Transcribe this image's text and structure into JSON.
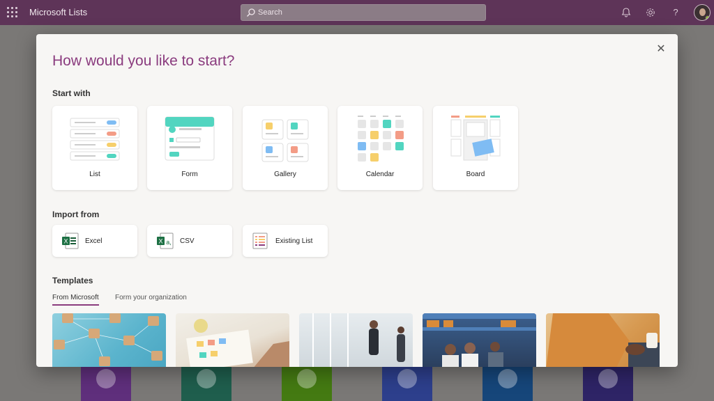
{
  "app": {
    "title": "Microsoft Lists"
  },
  "search": {
    "placeholder": "Search"
  },
  "topbar_icons": [
    "bell-icon",
    "gear-icon",
    "help-icon"
  ],
  "dialog": {
    "title": "How would you like to start?",
    "start_with": {
      "heading": "Start with",
      "options": [
        {
          "label": "List"
        },
        {
          "label": "Form"
        },
        {
          "label": "Gallery"
        },
        {
          "label": "Calendar"
        },
        {
          "label": "Board"
        }
      ]
    },
    "import_from": {
      "heading": "Import from",
      "options": [
        {
          "label": "Excel",
          "icon": "excel-icon"
        },
        {
          "label": "CSV",
          "icon": "csv-icon"
        },
        {
          "label": "Existing List",
          "icon": "existing-list-icon"
        }
      ]
    },
    "templates": {
      "heading": "Templates",
      "tabs": [
        {
          "label": "From Microsoft",
          "active": true
        },
        {
          "label": "Form your organization",
          "active": false
        }
      ]
    }
  },
  "colors": {
    "brand": "#5e3458",
    "accent": "#8a3b7e",
    "blue": "#7fbcf3",
    "orange": "#f39c86",
    "yellow": "#f6cf6b",
    "teal": "#52d5c0"
  }
}
